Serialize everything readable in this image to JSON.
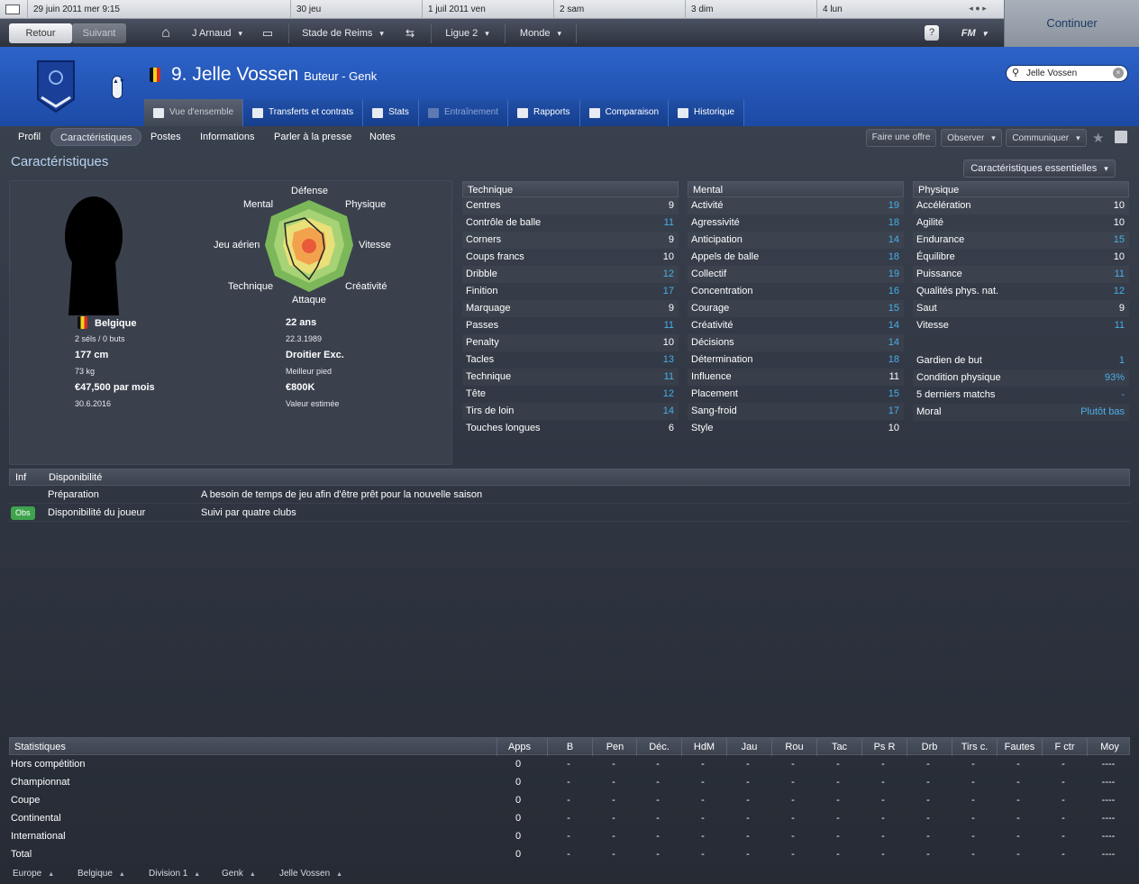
{
  "topbar": {
    "dates": [
      "29 juin 2011  mer  9:15",
      "30  jeu",
      "1 juil 2011  ven",
      "2  sam",
      "3  dim",
      "4  lun"
    ],
    "continue_label": "Continuer"
  },
  "nav": {
    "back": "Retour",
    "next": "Suivant",
    "manager": "J Arnaud",
    "club": "Stade de Reims",
    "league": "Ligue 2",
    "world": "Monde",
    "help": "?",
    "fm": "FM"
  },
  "player": {
    "title": "9. Jelle Vossen",
    "subtitle": "Buteur - Genk"
  },
  "search": {
    "value": "Jelle Vossen"
  },
  "tabs": [
    "Vue d'ensemble",
    "Transferts et contrats",
    "Stats",
    "Entraînement",
    "Rapports",
    "Comparaison",
    "Historique"
  ],
  "subnav": [
    "Profil",
    "Caractéristiques",
    "Postes",
    "Informations",
    "Parler à la presse",
    "Notes"
  ],
  "actions": {
    "offer": "Faire une offre",
    "observe": "Observer",
    "communicate": "Communiquer"
  },
  "section_title": "Caractéristiques",
  "carac_select": "Caractéristiques essentielles",
  "radar": {
    "top": "Défense",
    "tl": "Mental",
    "tr": "Physique",
    "l": "Jeu aérien",
    "r": "Vitesse",
    "bl": "Technique",
    "br": "Créativité",
    "bottom": "Attaque"
  },
  "profile": {
    "nation": "Belgique",
    "caps": "2 séls / 0 buts",
    "height": "177 cm",
    "weight": "73 kg",
    "wage": "€47,500 par mois",
    "contract": "30.6.2016",
    "age": "22 ans",
    "dob": "22.3.1989",
    "foot": "Droitier Exc.",
    "foot_label": "Meilleur pied",
    "value": "€800K",
    "value_label": "Valeur estimée"
  },
  "technique": {
    "title": "Technique",
    "rows": [
      [
        "Centres",
        "9",
        false
      ],
      [
        "Contrôle de balle",
        "11",
        true
      ],
      [
        "Corners",
        "9",
        false
      ],
      [
        "Coups francs",
        "10",
        false
      ],
      [
        "Dribble",
        "12",
        true
      ],
      [
        "Finition",
        "17",
        true
      ],
      [
        "Marquage",
        "9",
        false
      ],
      [
        "Passes",
        "11",
        true
      ],
      [
        "Penalty",
        "10",
        false
      ],
      [
        "Tacles",
        "13",
        true
      ],
      [
        "Technique",
        "11",
        true
      ],
      [
        "Tête",
        "12",
        true
      ],
      [
        "Tirs de loin",
        "14",
        true
      ],
      [
        "Touches longues",
        "6",
        false
      ]
    ]
  },
  "mental": {
    "title": "Mental",
    "rows": [
      [
        "Activité",
        "19",
        true
      ],
      [
        "Agressivité",
        "18",
        true
      ],
      [
        "Anticipation",
        "14",
        true
      ],
      [
        "Appels de balle",
        "18",
        true
      ],
      [
        "Collectif",
        "19",
        true
      ],
      [
        "Concentration",
        "16",
        true
      ],
      [
        "Courage",
        "15",
        true
      ],
      [
        "Créativité",
        "14",
        true
      ],
      [
        "Décisions",
        "14",
        true
      ],
      [
        "Détermination",
        "18",
        true
      ],
      [
        "Influence",
        "11",
        false
      ],
      [
        "Placement",
        "15",
        true
      ],
      [
        "Sang-froid",
        "17",
        true
      ],
      [
        "Style",
        "10",
        false
      ]
    ]
  },
  "physique": {
    "title": "Physique",
    "rows": [
      [
        "Accélération",
        "10",
        false
      ],
      [
        "Agilité",
        "10",
        false
      ],
      [
        "Endurance",
        "15",
        true
      ],
      [
        "Équilibre",
        "10",
        false
      ],
      [
        "Puissance",
        "11",
        true
      ],
      [
        "Qualités phys. nat.",
        "12",
        true
      ],
      [
        "Saut",
        "9",
        false
      ],
      [
        "Vitesse",
        "11",
        true
      ]
    ],
    "extra": [
      [
        "Gardien de but",
        "1",
        true
      ],
      [
        "Condition physique",
        "93%",
        true
      ],
      [
        "5 derniers matchs",
        "-",
        true
      ],
      [
        "Moral",
        "Plutôt bas",
        true
      ]
    ]
  },
  "info": {
    "head_inf": "Inf",
    "head_dispo": "Disponibilité",
    "rows": [
      {
        "badge": "",
        "label": "Préparation",
        "text": "A besoin de temps de jeu afin d'être prêt pour la nouvelle saison"
      },
      {
        "badge": "Obs",
        "label": "Disponibilité du joueur",
        "text": "Suivi par quatre clubs"
      }
    ]
  },
  "stats": {
    "head": "Statistiques",
    "cols": [
      "Apps",
      "B",
      "Pen",
      "Déc.",
      "HdM",
      "Jau",
      "Rou",
      "Tac",
      "Ps R",
      "Drb",
      "Tirs c.",
      "Fautes",
      "F ctr",
      "Moy"
    ],
    "rows": [
      [
        "Hors compétition",
        "0",
        "-",
        "-",
        "-",
        "-",
        "-",
        "-",
        "-",
        "-",
        "-",
        "-",
        "-",
        "-",
        "----"
      ],
      [
        "Championnat",
        "0",
        "-",
        "-",
        "-",
        "-",
        "-",
        "-",
        "-",
        "-",
        "-",
        "-",
        "-",
        "-",
        "----"
      ],
      [
        "Coupe",
        "0",
        "-",
        "-",
        "-",
        "-",
        "-",
        "-",
        "-",
        "-",
        "-",
        "-",
        "-",
        "-",
        "----"
      ],
      [
        "Continental",
        "0",
        "-",
        "-",
        "-",
        "-",
        "-",
        "-",
        "-",
        "-",
        "-",
        "-",
        "-",
        "-",
        "----"
      ],
      [
        "International",
        "0",
        "-",
        "-",
        "-",
        "-",
        "-",
        "-",
        "-",
        "-",
        "-",
        "-",
        "-",
        "-",
        "----"
      ],
      [
        "Total",
        "0",
        "-",
        "-",
        "-",
        "-",
        "-",
        "-",
        "-",
        "-",
        "-",
        "-",
        "-",
        "-",
        "----"
      ]
    ]
  },
  "breadcrumb": [
    "Europe",
    "Belgique",
    "Division 1",
    "Genk",
    "Jelle Vossen"
  ]
}
